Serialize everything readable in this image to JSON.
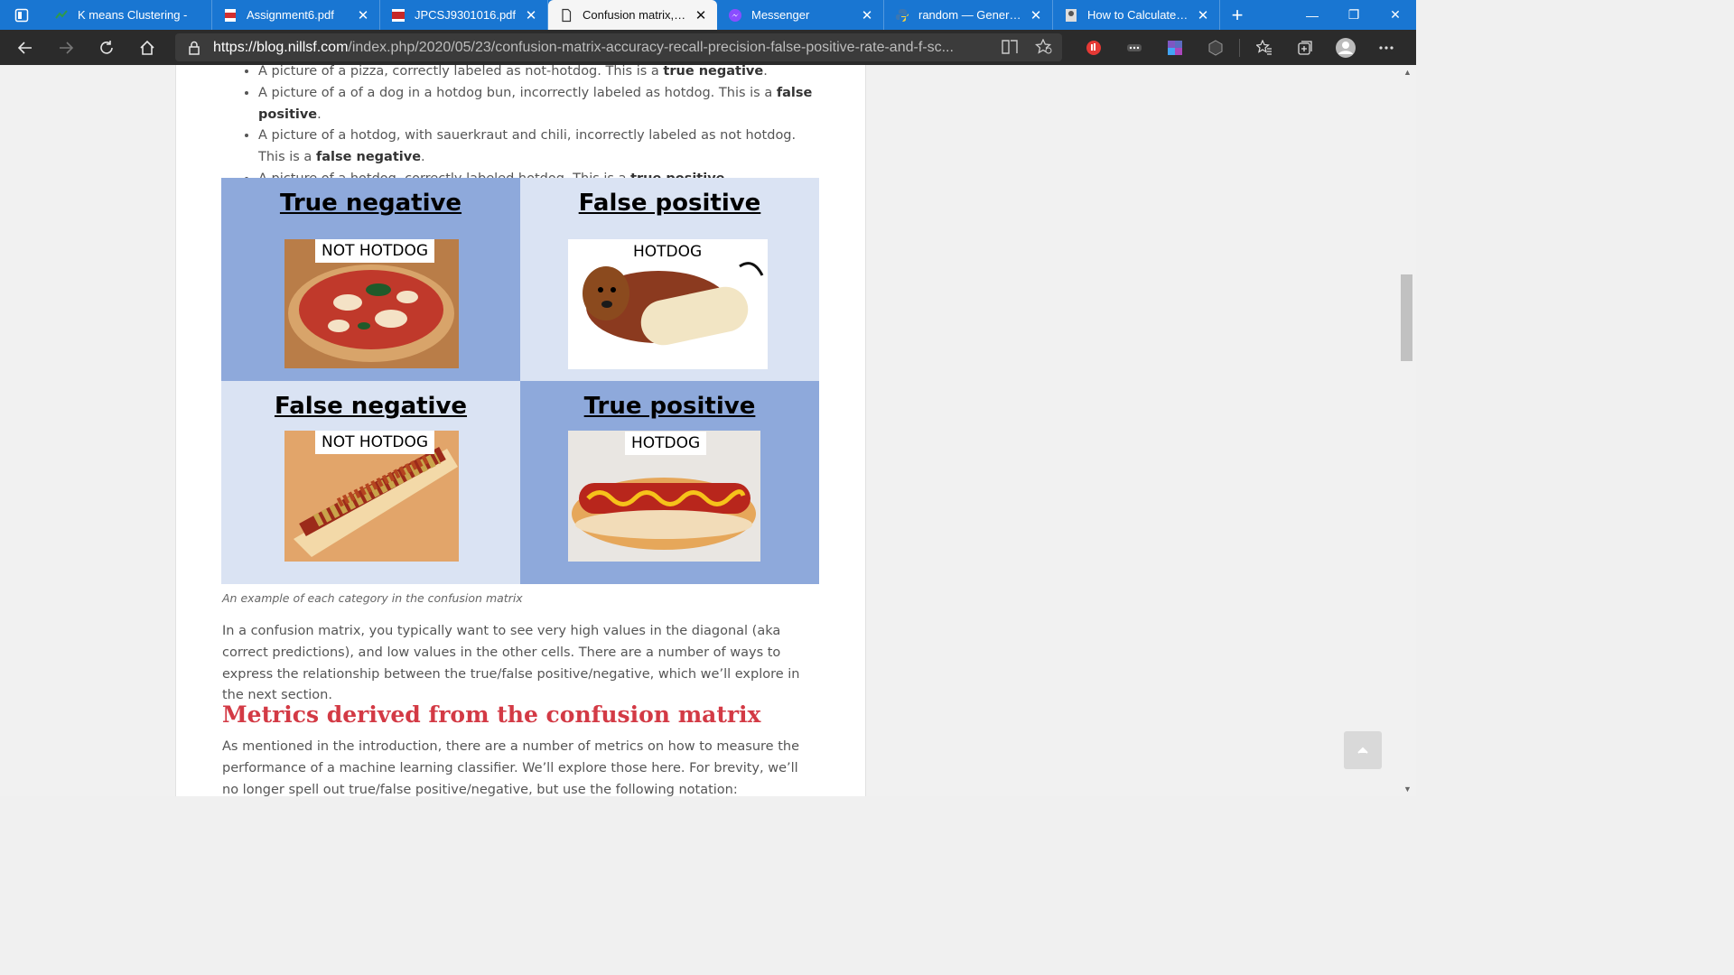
{
  "tabs": [
    {
      "title": "K means Clustering - ",
      "active": false
    },
    {
      "title": "Assignment6.pdf",
      "active": false
    },
    {
      "title": "JPCSJ9301016.pdf",
      "active": false
    },
    {
      "title": "Confusion matrix, accu",
      "active": true
    },
    {
      "title": "Messenger",
      "active": false
    },
    {
      "title": "random — Generate",
      "active": false
    },
    {
      "title": "How to Calculate Prec",
      "active": false
    }
  ],
  "address": {
    "prefix": "https://",
    "domain": "blog.nillsf.com",
    "path": "/index.php/2020/05/23/confusion-matrix-accuracy-recall-precision-false-positive-rate-and-f-sc..."
  },
  "bullets": [
    {
      "text": "A picture of a pizza, correctly labeled as not-hotdog. This is a ",
      "bold": "true negative",
      "end": "."
    },
    {
      "text": "A picture of a of a dog in a hotdog bun, incorrectly labeled as hotdog. This is a ",
      "bold": "false positive",
      "end": "."
    },
    {
      "text": "A picture of a hotdog, with sauerkraut and chili, incorrectly labeled as not hotdog. This is a ",
      "bold": "false negative",
      "end": "."
    },
    {
      "text": "A picture of a hotdog, correctly labeled hotdog. This is a ",
      "bold": "true positive",
      "end": "."
    }
  ],
  "matrix": {
    "tn": {
      "title": "True negative",
      "label": "NOT HOTDOG"
    },
    "fp": {
      "title": "False positive",
      "label": "HOTDOG"
    },
    "fn": {
      "title": "False negative",
      "label": "NOT HOTDOG"
    },
    "tp": {
      "title": "True positive",
      "label": "HOTDOG"
    }
  },
  "caption": "An example of each category in the confusion matrix",
  "paragraph1": "In a confusion matrix, you typically want to see very high values in the diagonal (aka correct predictions), and low values in the other cells. There are a number of ways to express the relationship between the true/false positive/negative, which we’ll explore in the next section.",
  "heading": "Metrics derived from the confusion matrix",
  "paragraph2": "As mentioned in the introduction, there are a number of metrics on how to measure the performance of a machine learning classifier. We’ll explore those here. For brevity, we’ll no longer spell out true/false positive/negative, but use the following notation:",
  "colors": {
    "tab_bar": "#1976d2",
    "heading": "#d33a45",
    "matrix_dark": "#8ea9db",
    "matrix_light": "#dae3f3"
  },
  "icons": [
    "workspaces-icon",
    "back-icon",
    "forward-icon",
    "refresh-icon",
    "home-icon",
    "lock-icon",
    "immersive-reader-icon",
    "add-favorite-icon",
    "extension-icon",
    "favorites-icon",
    "collections-icon",
    "profile-icon",
    "more-icon",
    "back-to-top-icon"
  ]
}
